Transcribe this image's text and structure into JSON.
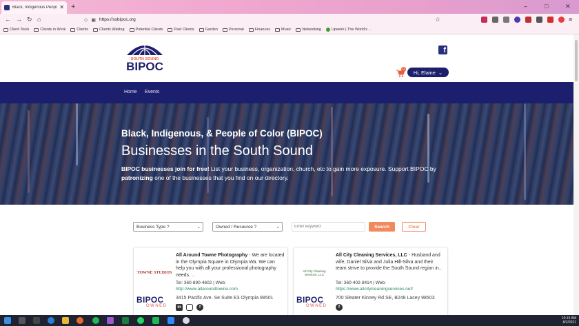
{
  "browser": {
    "tab_title": "Black, Indigenous People of Co",
    "new_tab": "+",
    "url": "https://ssbipoc.org",
    "window_controls": [
      "–",
      "□",
      "✕"
    ],
    "bookmarks": [
      {
        "label": "Client Tools",
        "type": "folder"
      },
      {
        "label": "Clients in Work",
        "type": "folder"
      },
      {
        "label": "Clients",
        "type": "folder"
      },
      {
        "label": "Clients Waiting",
        "type": "folder"
      },
      {
        "label": "Potential Clients",
        "type": "folder"
      },
      {
        "label": "Past Clients",
        "type": "folder"
      },
      {
        "label": "Garden",
        "type": "folder"
      },
      {
        "label": "Personal",
        "type": "folder"
      },
      {
        "label": "Finances",
        "type": "folder"
      },
      {
        "label": "Music",
        "type": "folder"
      },
      {
        "label": "Networking",
        "type": "folder"
      },
      {
        "label": "Upwork | The World's ...",
        "type": "link"
      }
    ]
  },
  "header": {
    "logo_top": "SOUTH SOUND",
    "logo_main": "BIPOC",
    "cart_count": "0",
    "user_greeting": "Hi, Elaine",
    "facebook_glyph": "f"
  },
  "menu": {
    "items": [
      "Home",
      "Events"
    ]
  },
  "hero": {
    "subtitle": "Black, Indigenous, & People of Color (BIPOC)",
    "title": "Businesses in the South Sound",
    "desc_bold1": "BIPOC businesses join for free!",
    "desc_part2": " List your business, organization, church, etc to gain more exposure. Support BIPOC by ",
    "desc_bold2": "patronizing",
    "desc_part3": " one of the businesses that you find on our directory."
  },
  "filters": {
    "business_type": "Business Type ?",
    "owned_resource": "Owned / Resource ?",
    "keyword_placeholder": "Enter keyword",
    "search_label": "Search",
    "clear_label": "Clear"
  },
  "listings": [
    {
      "name": "All Around Towne Photography",
      "desc": " - We are located in the Olympia Square in Olympia Wa.  We can help you with all your professional photography needs. ..",
      "tel": "Tel: 360-890-4602 | Web:",
      "web": "http://www.allaroundtowne.com",
      "address": "3415 Pacific Ave. Se Suite E3 Olympia 98501",
      "thumb": "TOWNE STUDIOS",
      "owned_main": "BIPOC",
      "owned_sub": "OWNED"
    },
    {
      "name": "All City Cleaning Services, LLC",
      "desc": " - Husband and wife, Daniel Silva and Julia Hill-Silva and their team strive to provide the South Sound region in..",
      "tel": "Tel: 360-402-8414 | Web:",
      "web": "https://www.allcitycleaningservices.net/",
      "address": "700 Sleater Kinney Rd SE, B248 Lacey 98503",
      "thumb": "All City Cleaning Services, LLC",
      "owned_main": "BIPOC",
      "owned_sub": "OWNED"
    }
  ],
  "taskbar": {
    "time": "10:15 AM",
    "date": "8/2/2021"
  },
  "colors": {
    "navy": "#1c1e6e",
    "orange": "#f08a5d",
    "link_green": "#2a8a5a"
  }
}
